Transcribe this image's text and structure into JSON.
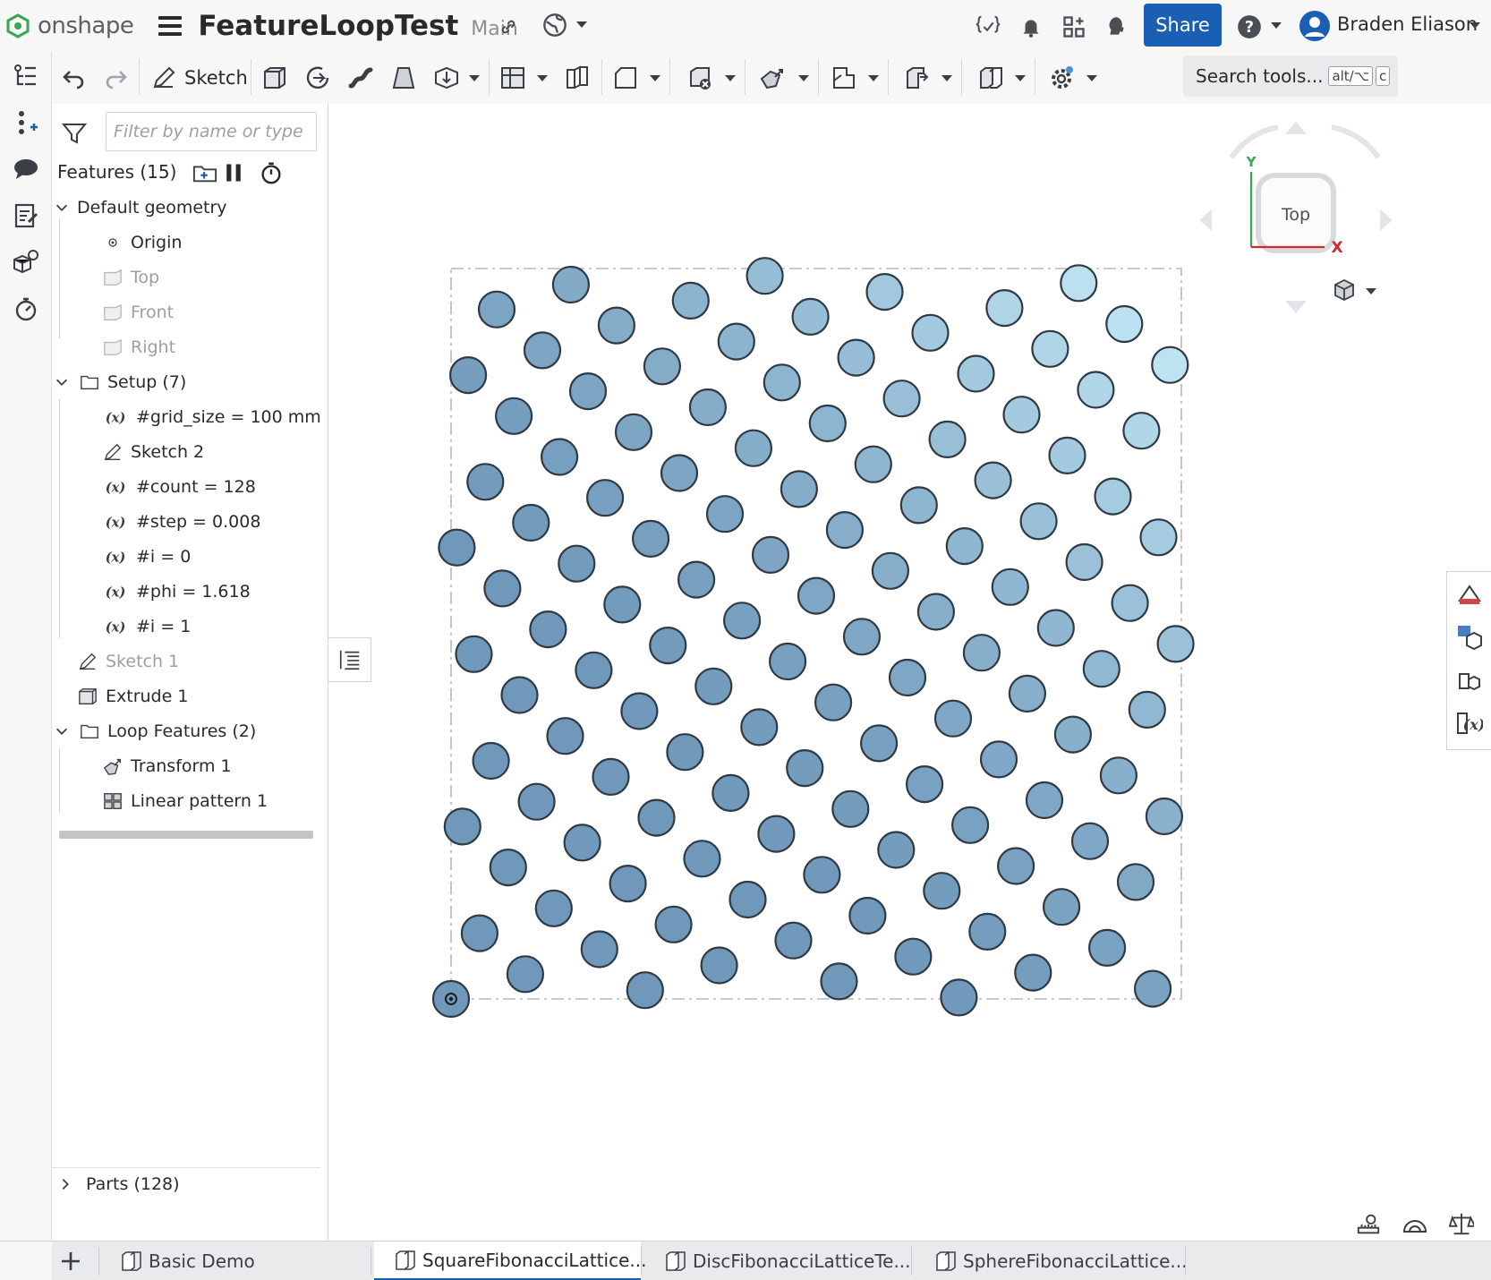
{
  "header": {
    "logo_text": "onshape",
    "document_title": "FeatureLoopTest",
    "branch": "Main",
    "share_label": "Share",
    "user_name": "Braden Eliason"
  },
  "toolbar": {
    "sketch_label": "Sketch",
    "search_label": "Search tools...",
    "search_shortcut_mod": "alt/⌥",
    "search_shortcut_key": "c"
  },
  "panel": {
    "filter_placeholder": "Filter by name or type",
    "features_title": "Features (15)",
    "tree": [
      {
        "label": "Default geometry",
        "icon": "chevron-down-icon",
        "dim": false
      },
      {
        "label": "Origin",
        "icon": "origin-icon",
        "dim": false
      },
      {
        "label": "Top",
        "icon": "plane-icon",
        "dim": true
      },
      {
        "label": "Front",
        "icon": "plane-icon",
        "dim": true
      },
      {
        "label": "Right",
        "icon": "plane-icon",
        "dim": true
      },
      {
        "label": "Setup (7)",
        "icon": "folder-icon",
        "dim": false
      },
      {
        "label": "#grid_size = 100 mm",
        "icon": "variable-icon",
        "dim": false
      },
      {
        "label": "Sketch 2",
        "icon": "sketch-icon",
        "dim": false
      },
      {
        "label": "#count = 128",
        "icon": "variable-icon",
        "dim": false
      },
      {
        "label": "#step = 0.008",
        "icon": "variable-icon",
        "dim": false
      },
      {
        "label": "#i = 0",
        "icon": "variable-icon",
        "dim": false
      },
      {
        "label": "#phi = 1.618",
        "icon": "variable-icon",
        "dim": false
      },
      {
        "label": "#i = 1",
        "icon": "variable-icon",
        "dim": false
      },
      {
        "label": "Sketch 1",
        "icon": "sketch-icon",
        "dim": true
      },
      {
        "label": "Extrude 1",
        "icon": "extrude-icon",
        "dim": false
      },
      {
        "label": "Loop Features (2)",
        "icon": "folder-icon",
        "dim": false
      },
      {
        "label": "Transform 1",
        "icon": "transform-icon",
        "dim": false
      },
      {
        "label": "Linear pattern 1",
        "icon": "linear-pattern-icon",
        "dim": false
      }
    ],
    "parts_label": "Parts (128)"
  },
  "viewcube": {
    "face_label": "Top",
    "axis_x": "X",
    "axis_y": "Y"
  },
  "tabs": [
    {
      "label": "Basic Demo",
      "active": false
    },
    {
      "label": "SquareFibonacciLattice...",
      "active": true
    },
    {
      "label": "DiscFibonacciLatticeTe...",
      "active": false
    },
    {
      "label": "SphereFibonacciLattice...",
      "active": false
    }
  ],
  "colors": {
    "accent": "#1a5fb4",
    "disc_base": "#6f98ba",
    "disc_light": "#c8eefb"
  }
}
